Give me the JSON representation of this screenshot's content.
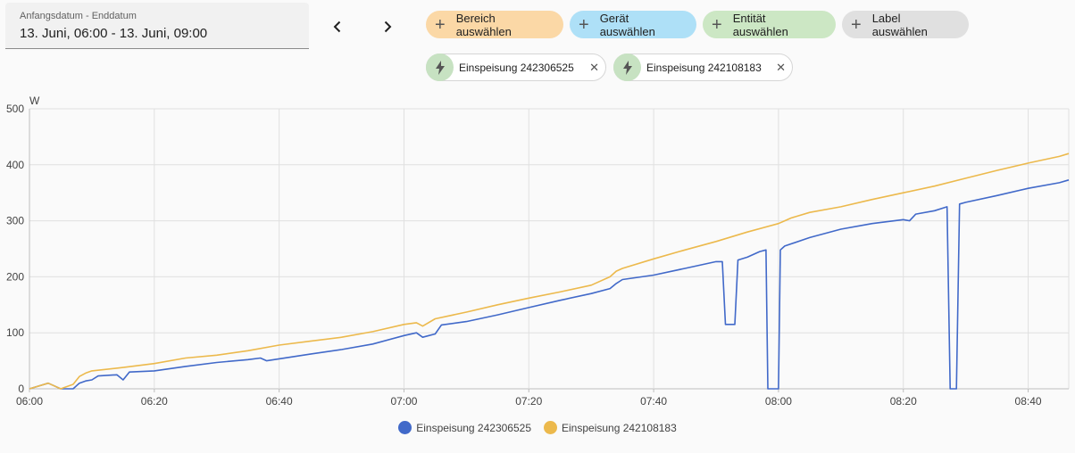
{
  "date_range": {
    "label": "Anfangsdatum - Enddatum",
    "value": "13. Juni, 06:00 - 13. Juni, 09:00"
  },
  "nav": {
    "prev_icon": "chevron-left-icon",
    "next_icon": "chevron-right-icon"
  },
  "target_chips": [
    {
      "label": "Bereich auswählen",
      "color": "#fbd8a6",
      "icon": "plus-icon"
    },
    {
      "label": "Gerät auswählen",
      "color": "#aee0f7",
      "icon": "plus-icon"
    },
    {
      "label": "Entität auswählen",
      "color": "#cce7c4",
      "icon": "plus-icon"
    },
    {
      "label": "Label auswählen",
      "color": "#e0e0e0",
      "icon": "plus-icon"
    }
  ],
  "entity_chips": [
    {
      "label": "Einspeisung 242306525",
      "icon": "flash-icon",
      "close_icon": "close-icon"
    },
    {
      "label": "Einspeisung 242108183",
      "icon": "flash-icon",
      "close_icon": "close-icon"
    }
  ],
  "chart_data": {
    "type": "line",
    "title": "",
    "xlabel": "",
    "ylabel": "W",
    "ylim": [
      0,
      500
    ],
    "yticks": [
      "0",
      "100",
      "200",
      "300",
      "400",
      "500"
    ],
    "xlim_minutes": [
      0,
      166.5
    ],
    "xticks": [
      "06:00",
      "06:20",
      "06:40",
      "07:00",
      "07:20",
      "07:40",
      "08:00",
      "08:20",
      "08:40"
    ],
    "grid": true,
    "legend_position": "bottom",
    "series": [
      {
        "name": "Einspeisung 242306525",
        "color": "#4169c9",
        "points": [
          [
            "06:00",
            0
          ],
          [
            "06:03",
            10
          ],
          [
            "06:05",
            0
          ],
          [
            "06:07",
            0
          ],
          [
            "06:08",
            10
          ],
          [
            "06:09",
            14
          ],
          [
            "06:10",
            16
          ],
          [
            "06:11",
            23
          ],
          [
            "06:14",
            25
          ],
          [
            "06:15",
            16
          ],
          [
            "06:16",
            30
          ],
          [
            "06:20",
            32
          ],
          [
            "06:25",
            40
          ],
          [
            "06:30",
            47
          ],
          [
            "06:35",
            52
          ],
          [
            "06:37",
            55
          ],
          [
            "06:38",
            50
          ],
          [
            "06:45",
            62
          ],
          [
            "06:50",
            70
          ],
          [
            "06:55",
            80
          ],
          [
            "07:00",
            95
          ],
          [
            "07:02",
            100
          ],
          [
            "07:03",
            92
          ],
          [
            "07:04",
            95
          ],
          [
            "07:05",
            98
          ],
          [
            "07:06",
            114
          ],
          [
            "07:10",
            120
          ],
          [
            "07:15",
            132
          ],
          [
            "07:20",
            145
          ],
          [
            "07:25",
            158
          ],
          [
            "07:30",
            170
          ],
          [
            "07:33",
            179
          ],
          [
            "07:34",
            188
          ],
          [
            "07:35",
            195
          ],
          [
            "07:40",
            203
          ],
          [
            "07:45",
            215
          ],
          [
            "07:50",
            227
          ],
          [
            "07:51",
            227
          ],
          [
            "07:51.5",
            115
          ],
          [
            "07:53",
            115
          ],
          [
            "07:53.5",
            230
          ],
          [
            "07:55",
            235
          ],
          [
            "07:57",
            245
          ],
          [
            "07:58",
            248
          ],
          [
            "07:58.3",
            0
          ],
          [
            "08:00",
            0
          ],
          [
            "08:00.3",
            248
          ],
          [
            "08:01",
            255
          ],
          [
            "08:05",
            270
          ],
          [
            "08:10",
            285
          ],
          [
            "08:15",
            295
          ],
          [
            "08:20",
            302
          ],
          [
            "08:21",
            300
          ],
          [
            "08:22",
            312
          ],
          [
            "08:25",
            318
          ],
          [
            "08:27",
            325
          ],
          [
            "08:27.5",
            0
          ],
          [
            "08:28.5",
            0
          ],
          [
            "08:29",
            330
          ],
          [
            "08:30",
            333
          ],
          [
            "08:35",
            345
          ],
          [
            "08:40",
            358
          ],
          [
            "08:45",
            368
          ],
          [
            "08:46.5",
            373
          ]
        ]
      },
      {
        "name": "Einspeisung 242108183",
        "color": "#ecb94c",
        "points": [
          [
            "06:00",
            0
          ],
          [
            "06:03",
            10
          ],
          [
            "06:05",
            0
          ],
          [
            "06:07",
            8
          ],
          [
            "06:08",
            22
          ],
          [
            "06:09",
            28
          ],
          [
            "06:10",
            32
          ],
          [
            "06:15",
            38
          ],
          [
            "06:20",
            45
          ],
          [
            "06:25",
            55
          ],
          [
            "06:30",
            60
          ],
          [
            "06:35",
            68
          ],
          [
            "06:40",
            78
          ],
          [
            "06:45",
            85
          ],
          [
            "06:50",
            92
          ],
          [
            "06:55",
            102
          ],
          [
            "07:00",
            115
          ],
          [
            "07:02",
            118
          ],
          [
            "07:03",
            112
          ],
          [
            "07:05",
            125
          ],
          [
            "07:10",
            137
          ],
          [
            "07:15",
            150
          ],
          [
            "07:20",
            162
          ],
          [
            "07:25",
            173
          ],
          [
            "07:30",
            185
          ],
          [
            "07:33",
            200
          ],
          [
            "07:34",
            210
          ],
          [
            "07:35",
            215
          ],
          [
            "07:40",
            232
          ],
          [
            "07:45",
            248
          ],
          [
            "07:50",
            263
          ],
          [
            "07:55",
            280
          ],
          [
            "08:00",
            295
          ],
          [
            "08:01",
            300
          ],
          [
            "08:02",
            305
          ],
          [
            "08:05",
            315
          ],
          [
            "08:10",
            325
          ],
          [
            "08:15",
            338
          ],
          [
            "08:20",
            350
          ],
          [
            "08:25",
            362
          ],
          [
            "08:30",
            376
          ],
          [
            "08:35",
            390
          ],
          [
            "08:40",
            403
          ],
          [
            "08:45",
            415
          ],
          [
            "08:46.5",
            420
          ]
        ]
      }
    ]
  }
}
